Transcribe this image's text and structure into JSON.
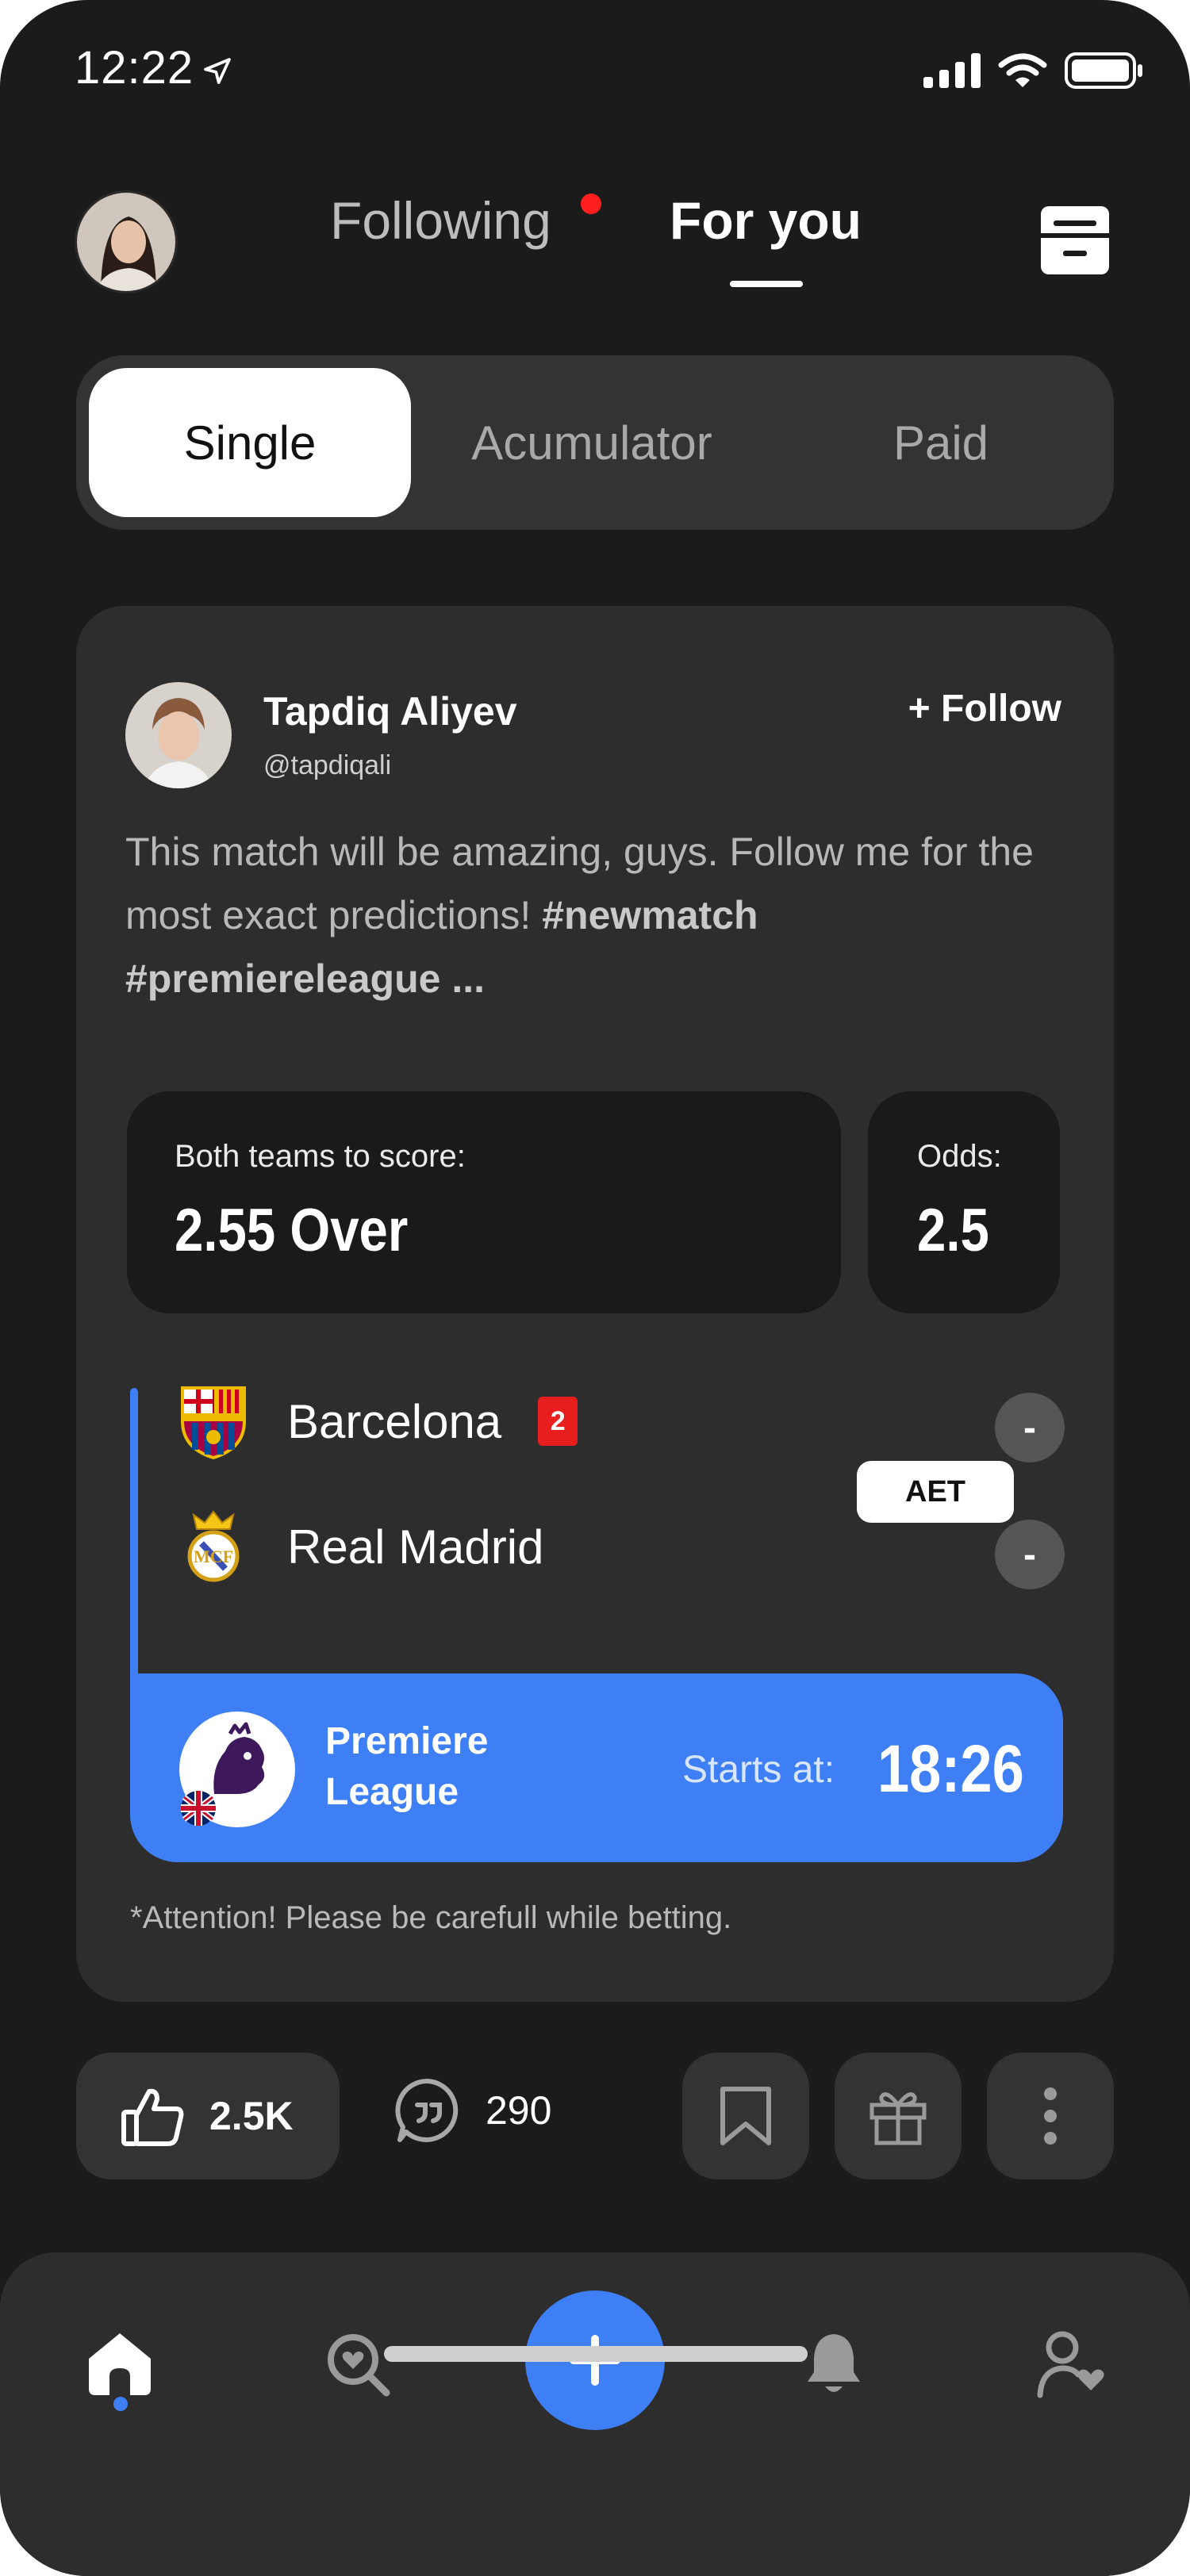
{
  "status_bar": {
    "time": "12:22"
  },
  "header": {
    "tabs": [
      {
        "label": "Following",
        "has_notification": true
      },
      {
        "label": "For you",
        "active": true
      }
    ]
  },
  "segments": [
    {
      "label": "Single",
      "selected": true
    },
    {
      "label": "Acumulator"
    },
    {
      "label": "Paid"
    }
  ],
  "post": {
    "author_name": "Tapdiq Aliyev",
    "author_handle": "@tapdiqali",
    "follow_label": "+ Follow",
    "text_plain": "This match will be amazing, guys. Follow me for the most exact predictions! ",
    "tag1": "#newmatch",
    "tag2": "#premiereleague ...",
    "bet": {
      "label": "Both teams to score:",
      "value": "2.55 Over"
    },
    "odds": {
      "label": "Odds:",
      "value": "2.5"
    },
    "match": {
      "home_team": "Barcelona",
      "home_red_cards": "2",
      "home_score": "-",
      "away_team": "Real Madrid",
      "away_score": "-",
      "status_badge": "AET"
    },
    "league": {
      "name": "Premiere League",
      "starts_label": "Starts at:",
      "start_time": "18:26"
    },
    "disclaimer": "*Attention! Please be carefull while betting."
  },
  "actions": {
    "likes": "2.5K",
    "comments": "290"
  },
  "colors": {
    "background": "#1b1b1b",
    "card": "#2d2d2d",
    "accent": "#3f7ff5",
    "red": "#e81d1d"
  },
  "icons": [
    "location-arrow-icon",
    "signal-icon",
    "wifi-icon",
    "battery-icon",
    "document-icon",
    "thumbs-up-icon",
    "comment-icon",
    "bookmark-icon",
    "gift-icon",
    "more-vertical-icon",
    "home-icon",
    "search-icon",
    "plus-icon",
    "bell-icon",
    "profile-heart-icon"
  ]
}
